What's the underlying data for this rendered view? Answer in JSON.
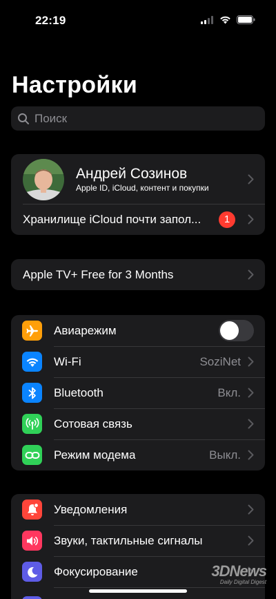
{
  "status_bar": {
    "time": "22:19"
  },
  "title": "Настройки",
  "search": {
    "placeholder": "Поиск"
  },
  "profile": {
    "name": "Андрей Созинов",
    "subtitle": "Apple ID, iCloud, контент и покупки",
    "storage_warning": "Хранилище iCloud почти запол...",
    "badge": "1"
  },
  "promo": {
    "label": "Apple TV+ Free for 3 Months"
  },
  "connectivity": [
    {
      "label": "Авиарежим",
      "icon": "airplane-icon",
      "color": "#ff9f0a",
      "toggle": false
    },
    {
      "label": "Wi-Fi",
      "icon": "wifi-icon",
      "color": "#0a84ff",
      "value": "SoziNet"
    },
    {
      "label": "Bluetooth",
      "icon": "bluetooth-icon",
      "color": "#0a84ff",
      "value": "Вкл."
    },
    {
      "label": "Сотовая связь",
      "icon": "antenna-icon",
      "color": "#30d158",
      "value": ""
    },
    {
      "label": "Режим модема",
      "icon": "chain-link-icon",
      "color": "#30d158",
      "value": "Выкл."
    }
  ],
  "notifications": [
    {
      "label": "Уведомления",
      "icon": "bell-icon",
      "color": "#ff453a"
    },
    {
      "label": "Звуки, тактильные сигналы",
      "icon": "speaker-icon",
      "color": "#ff375f"
    },
    {
      "label": "Фокусирование",
      "icon": "moon-icon",
      "color": "#5e5ce6"
    }
  ],
  "watermark": {
    "brand": "3DNews",
    "tagline": "Daily Digital Digest"
  }
}
